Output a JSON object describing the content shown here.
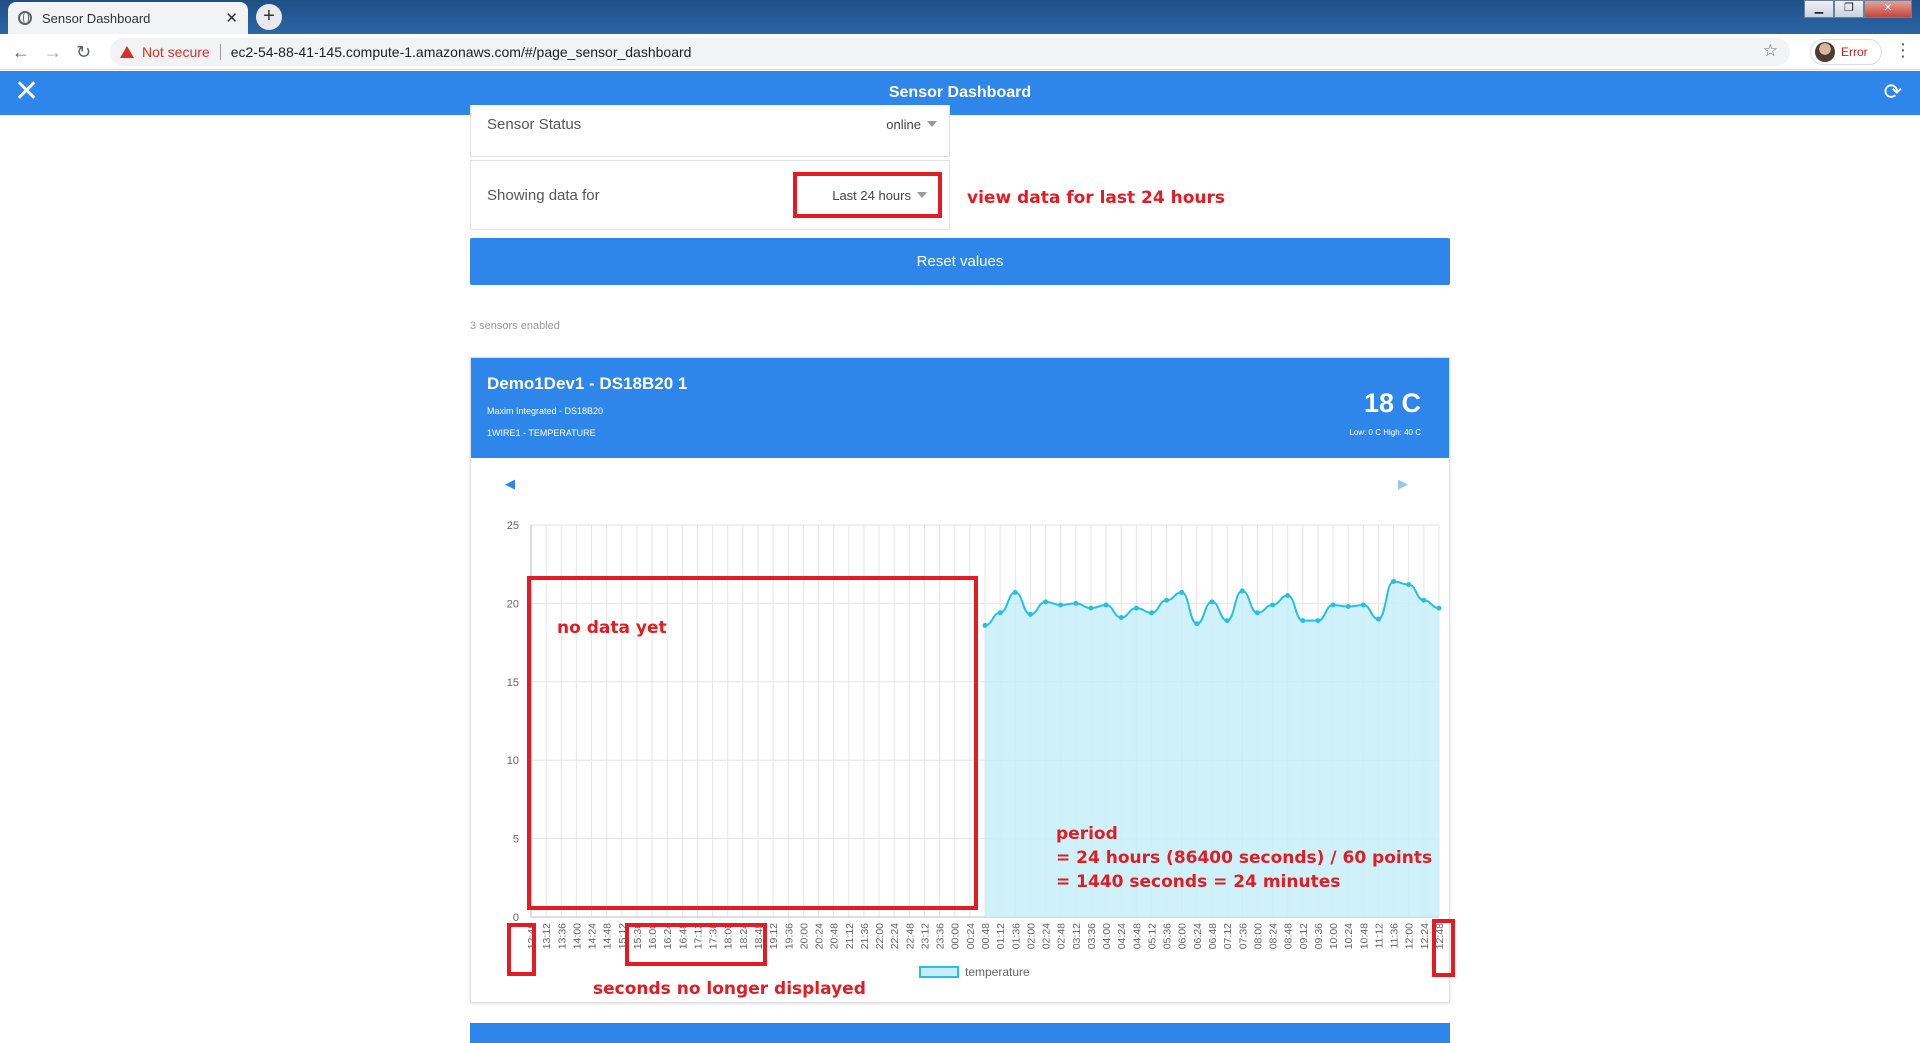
{
  "browser": {
    "tab_title": "Sensor Dashboard",
    "tab_close": "✕",
    "new_tab": "+",
    "not_secure": "Not secure",
    "url": "ec2-54-88-41-145.compute-1.amazonaws.com/#/page_sensor_dashboard",
    "profile_label": "Error"
  },
  "app": {
    "title": "Sensor Dashboard",
    "sensor_status_label": "Sensor Status",
    "sensor_status_value": "online",
    "showing_label": "Showing data for",
    "showing_value": "Last 24 hours",
    "reset_label": "Reset values",
    "sensors_enabled": "3 sensors enabled"
  },
  "card": {
    "name": "Demo1Dev1 - DS18B20 1",
    "maker": "Maxim Integrated - DS18B20",
    "type": "1WIRE1 - TEMPERATURE",
    "reading": "18 C",
    "range": "Low: 0 C High: 40 C"
  },
  "annotations": {
    "view_data": "view data for last 24 hours",
    "no_data": "no data yet",
    "period_1": "period",
    "period_2": "= 24 hours (86400 seconds) / 60 points",
    "period_3": "= 1440 seconds = 24 minutes",
    "seconds": "seconds no longer displayed"
  },
  "colors": {
    "brand_blue": "#2e86ea",
    "line": "#27bfe8",
    "fill": "#c7eef9",
    "annotation_red": "#e31b23"
  },
  "chart_data": {
    "type": "area",
    "ylim": [
      0,
      25
    ],
    "yticks": [
      0,
      5,
      10,
      15,
      20,
      25
    ],
    "categories": [
      "12:48",
      "13:12",
      "13:36",
      "14:00",
      "14:24",
      "14:48",
      "15:12",
      "15:36",
      "16:00",
      "16:24",
      "16:48",
      "17:12",
      "17:36",
      "18:00",
      "18:24",
      "18:48",
      "19:12",
      "19:36",
      "20:00",
      "20:24",
      "20:48",
      "21:12",
      "21:36",
      "22:00",
      "22:24",
      "22:48",
      "23:12",
      "23:36",
      "00:00",
      "00:24",
      "00:48",
      "01:12",
      "01:36",
      "02:00",
      "02:24",
      "02:48",
      "03:12",
      "03:36",
      "04:00",
      "04:24",
      "04:48",
      "05:12",
      "05:36",
      "06:00",
      "06:24",
      "06:48",
      "07:12",
      "07:36",
      "08:00",
      "08:24",
      "08:48",
      "09:12",
      "09:36",
      "10:00",
      "10:24",
      "10:48",
      "11:12",
      "11:36",
      "12:00",
      "12:24",
      "12:48"
    ],
    "series": [
      {
        "name": "temperature",
        "start_index": 30,
        "values": [
          18.6,
          19.4,
          20.7,
          19.3,
          20.1,
          19.9,
          20.0,
          19.7,
          19.9,
          19.1,
          19.7,
          19.4,
          20.2,
          20.7,
          18.7,
          20.1,
          18.9,
          20.8,
          19.4,
          19.9,
          20.5,
          18.9,
          18.9,
          19.9,
          19.8,
          19.9,
          19.0,
          21.4,
          21.2,
          20.2,
          19.7
        ]
      }
    ],
    "legend": "bottom"
  }
}
